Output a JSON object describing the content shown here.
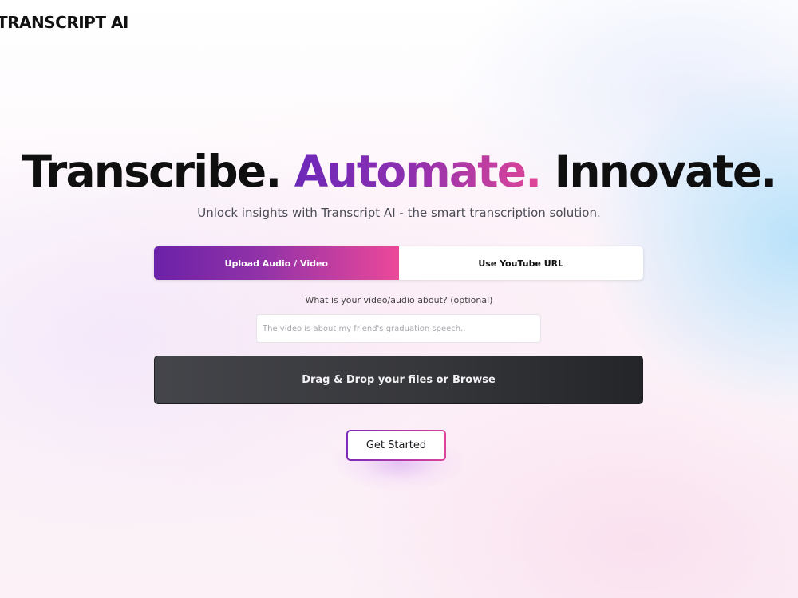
{
  "brand": {
    "logo_text": "TRANSCRIPT AI"
  },
  "hero": {
    "word1": "Transcribe.",
    "word2": "Automate.",
    "word3": "Innovate.",
    "subtitle": "Unlock insights with Transcript AI - the smart transcription solution."
  },
  "tabs": [
    {
      "label": "Upload Audio / Video",
      "active": true
    },
    {
      "label": "Use YouTube URL",
      "active": false
    }
  ],
  "about": {
    "question": "What is your video/audio about? (optional)",
    "placeholder": "The video is about my friend's graduation speech..",
    "value": ""
  },
  "dropzone": {
    "text": "Drag & Drop your files or",
    "browse_label": "Browse"
  },
  "cta": {
    "label": "Get Started"
  },
  "colors": {
    "accent_start": "#6b21a8",
    "accent_end": "#ec4899",
    "dropzone_bg": "#36373b"
  }
}
